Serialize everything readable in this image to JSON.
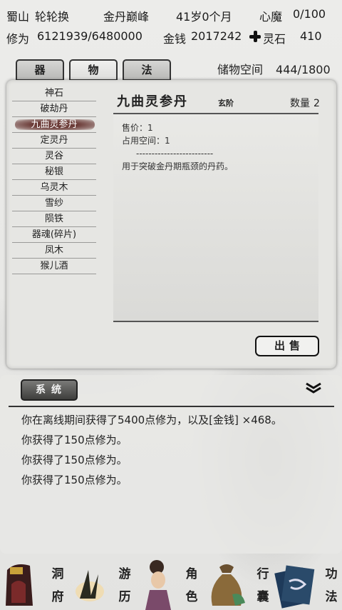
{
  "status": {
    "location": "蜀山",
    "player_name": "轮轮换",
    "realm": "金丹巅峰",
    "age": "41岁0个月",
    "demon_label": "心魔",
    "demon_value": "0/100",
    "cultivation_label": "修为",
    "cultivation_value": "6121939/6480000",
    "money_label": "金钱",
    "money_value": "2017242",
    "spirit_stone_label": "灵石",
    "spirit_stone_value": "410"
  },
  "tabs": [
    "器",
    "物",
    "法"
  ],
  "active_tab": 1,
  "storage": {
    "label": "储物空间",
    "value": "444/1800"
  },
  "items": [
    "神石",
    "破劫丹",
    "九曲灵参丹",
    "定灵丹",
    "灵谷",
    "秘银",
    "乌灵木",
    "雪纱",
    "陨铁",
    "器魂(碎片)",
    "凤木",
    "猴儿酒"
  ],
  "selected_item": 2,
  "detail": {
    "name": "九曲灵参丹",
    "grade": "玄阶",
    "quantity_label": "数量",
    "quantity": "2",
    "price": "售价：1",
    "space": "占用空间：1",
    "separator": "-------------------------",
    "description": "用于突破金丹期瓶颈的丹药。"
  },
  "sell_button": "出售",
  "log": {
    "tab_label": "系统",
    "messages": [
      "你在离线期间获得了5400点修为，以及[金钱] ×468。",
      "你获得了150点修为。",
      "你获得了150点修为。",
      "你获得了150点修为。"
    ]
  },
  "nav": [
    {
      "label": "洞府",
      "icon": "cave-icon"
    },
    {
      "label": "游历",
      "icon": "travel-icon"
    },
    {
      "label": "角色",
      "icon": "character-icon"
    },
    {
      "label": "行囊",
      "icon": "bag-icon"
    },
    {
      "label": "功法",
      "icon": "book-icon"
    }
  ],
  "colors": {
    "selected_item_bg": "#6b3b37",
    "sys_button_bg": "#4a4a48",
    "page_bg": "#e9e9e7"
  }
}
